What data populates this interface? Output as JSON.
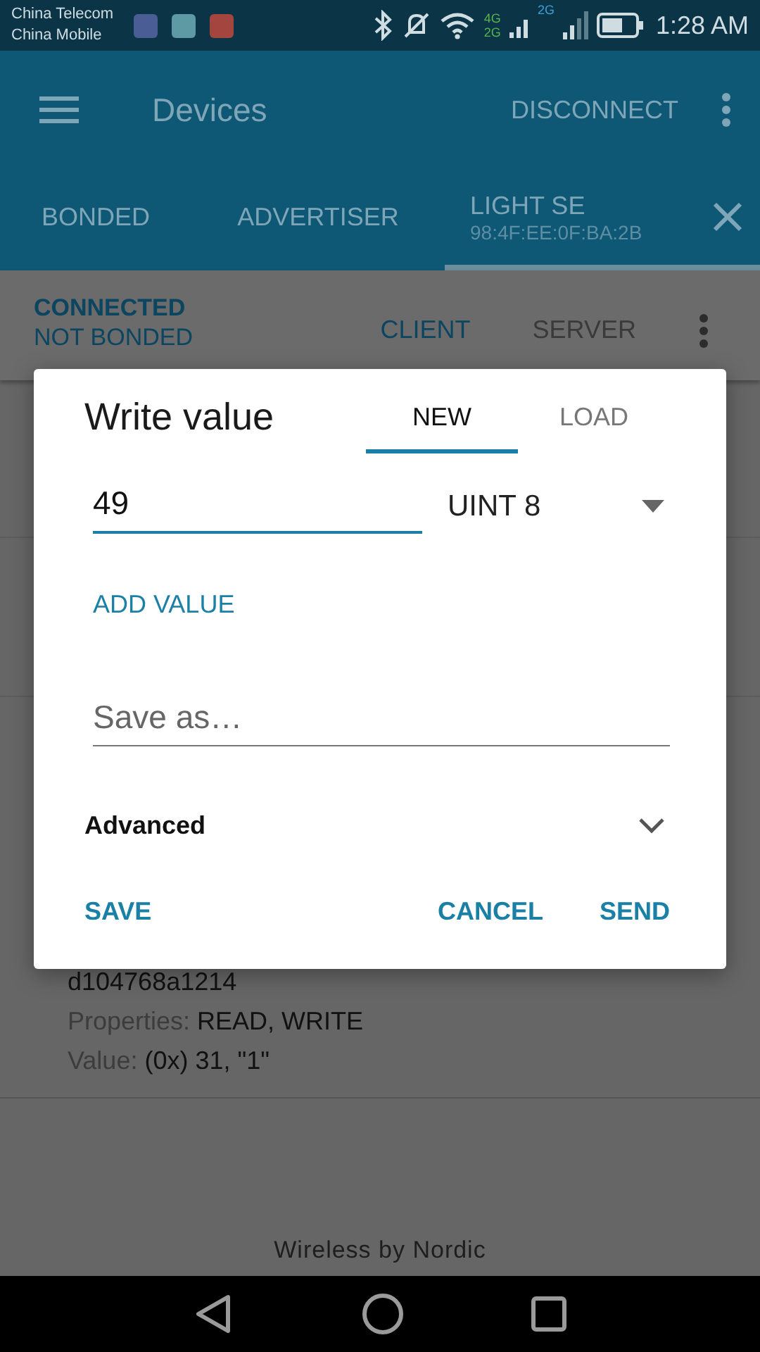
{
  "status_bar": {
    "carriers": [
      "China Telecom",
      "China Mobile"
    ],
    "network_labels": [
      "4G",
      "2G",
      "2G"
    ],
    "time": "1:28 AM"
  },
  "toolbar": {
    "title": "Devices",
    "action": "DISCONNECT"
  },
  "device_tabs": [
    {
      "label": "BONDED",
      "selected": false
    },
    {
      "label": "ADVERTISER",
      "selected": false
    },
    {
      "label": "LIGHT SE",
      "address": "98:4F:EE:0F:BA:2B",
      "selected": true
    }
  ],
  "connection": {
    "state": "CONNECTED",
    "bond": "NOT BONDED",
    "tabs": [
      {
        "label": "CLIENT",
        "selected": true
      },
      {
        "label": "SERVER",
        "selected": false
      }
    ]
  },
  "characteristic": {
    "uuid": "d104768a1214",
    "properties_label": "Properties:",
    "properties": "READ, WRITE",
    "value_label": "Value:",
    "value": "(0x) 31, \"1\""
  },
  "footer": "Wireless by Nordic",
  "dialog": {
    "title": "Write value",
    "tabs": [
      {
        "label": "NEW",
        "selected": true
      },
      {
        "label": "LOAD",
        "selected": false
      }
    ],
    "value_field": {
      "value": "49",
      "focused": true
    },
    "format": "UINT 8",
    "add_value": "ADD VALUE",
    "save_as": {
      "placeholder": "Save as…"
    },
    "advanced": {
      "label": "Advanced",
      "expanded": false
    },
    "buttons": [
      {
        "label": "SAVE",
        "kind": "left"
      },
      {
        "label": "CANCEL",
        "kind": "right"
      },
      {
        "label": "SEND",
        "kind": "right"
      }
    ]
  }
}
